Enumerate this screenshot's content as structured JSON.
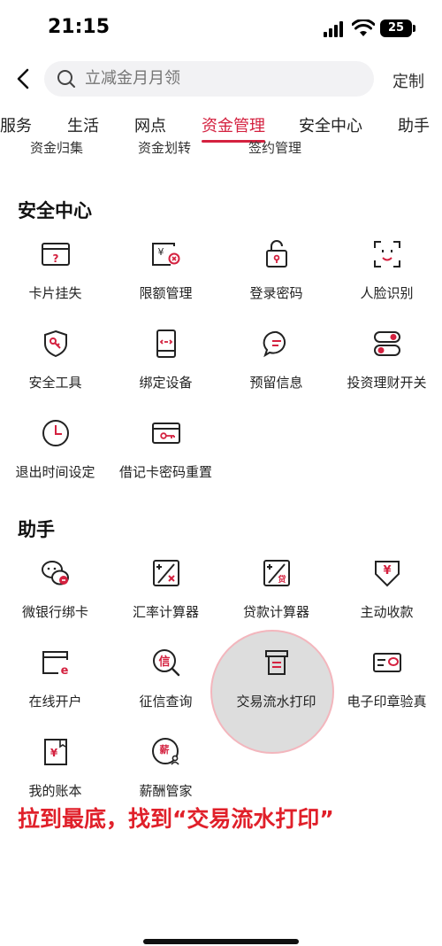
{
  "status": {
    "time": "21:15",
    "battery": "25"
  },
  "header": {
    "search_placeholder": "立减金月月领",
    "customize": "定制"
  },
  "tabs": [
    "服务",
    "生活",
    "网点",
    "资金管理",
    "安全中心",
    "助手"
  ],
  "active_tab": "资金管理",
  "accent_color": "#d4213f",
  "partial_items": [
    "资金归集",
    "资金划转",
    "签约管理"
  ],
  "security": {
    "title": "安全中心",
    "items": [
      {
        "label": "卡片挂失",
        "icon": "card-question-icon"
      },
      {
        "label": "限额管理",
        "icon": "limit-card-icon"
      },
      {
        "label": "登录密码",
        "icon": "lock-icon"
      },
      {
        "label": "人脸识别",
        "icon": "face-scan-icon"
      },
      {
        "label": "安全工具",
        "icon": "shield-icon"
      },
      {
        "label": "绑定设备",
        "icon": "phone-device-icon"
      },
      {
        "label": "预留信息",
        "icon": "chat-bubble-icon"
      },
      {
        "label": "投资理财开关",
        "icon": "toggle-switch-icon"
      },
      {
        "label": "退出时间设定",
        "icon": "clock-icon"
      },
      {
        "label": "借记卡密码重置",
        "icon": "card-key-icon"
      }
    ]
  },
  "assistant": {
    "title": "助手",
    "items": [
      {
        "label": "微银行绑卡",
        "icon": "wechat-link-icon"
      },
      {
        "label": "汇率计算器",
        "icon": "exchange-calculator-icon"
      },
      {
        "label": "贷款计算器",
        "icon": "loan-calculator-icon"
      },
      {
        "label": "主动收款",
        "icon": "receive-money-icon"
      },
      {
        "label": "在线开户",
        "icon": "open-account-icon"
      },
      {
        "label": "征信查询",
        "icon": "credit-query-icon"
      },
      {
        "label": "交易流水打印",
        "icon": "printer-icon"
      },
      {
        "label": "电子印章验真",
        "icon": "seal-verify-icon"
      },
      {
        "label": "我的账本",
        "icon": "ledger-icon"
      },
      {
        "label": "薪酬管家",
        "icon": "salary-icon"
      }
    ]
  },
  "annotation": "拉到最底，找到“交易流水打印”"
}
